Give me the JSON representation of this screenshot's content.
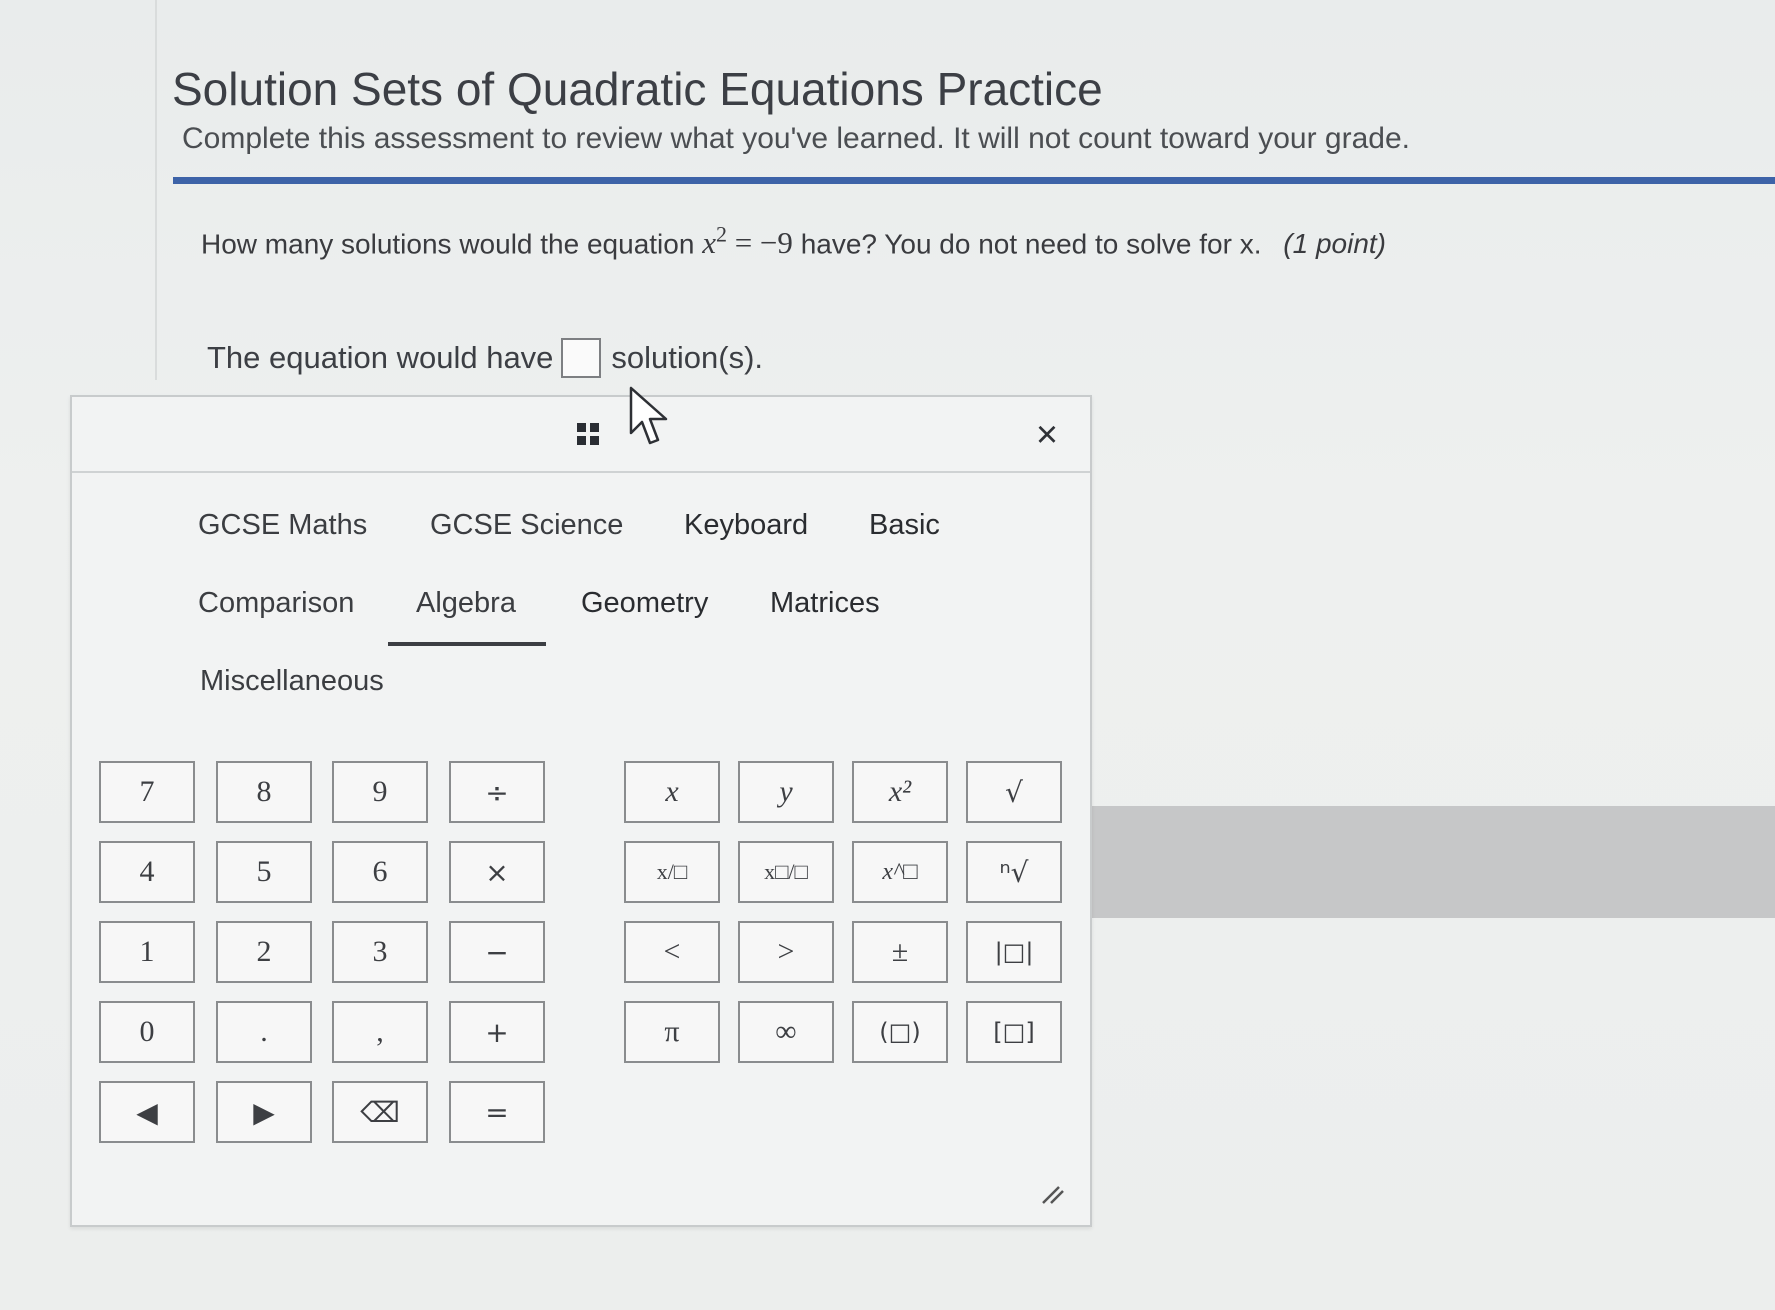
{
  "page": {
    "title": "Solution Sets of Quadratic Equations Practice",
    "subtitle": "Complete this assessment to review what you've learned. It will not count toward your grade.",
    "accent_color": "#3d63a8"
  },
  "question": {
    "prefix": "How many solutions would the equation",
    "equation_var": "x",
    "equation_exp": "2",
    "equation_rest": " = −9",
    "suffix": " have? You do not need to solve for x.",
    "points": "(1 point)"
  },
  "answer": {
    "before": "The equation would have",
    "value": "",
    "after": "solution(s)."
  },
  "palette": {
    "close_label": "×",
    "tabs_row1": [
      "GCSE Maths",
      "GCSE Science",
      "Keyboard",
      "Basic"
    ],
    "tabs_row2": [
      "Comparison",
      "Algebra",
      "Geometry",
      "Matrices"
    ],
    "tabs_row3": [
      "Miscellaneous"
    ],
    "selected_tab": "Algebra",
    "number_keys": [
      [
        "7",
        "8",
        "9",
        "÷"
      ],
      [
        "4",
        "5",
        "6",
        "×"
      ],
      [
        "1",
        "2",
        "3",
        "−"
      ],
      [
        "0",
        ".",
        ",",
        "+"
      ],
      [
        "◀",
        "▶",
        "⌫",
        "="
      ]
    ],
    "algebra_keys": [
      [
        "x",
        "y",
        "x²",
        "√"
      ],
      [
        "x/□",
        "x□/□",
        "x^□",
        "ⁿ√"
      ],
      [
        "<",
        ">",
        "±",
        "|□|"
      ],
      [
        "π",
        "∞",
        "(□)",
        "[□]"
      ]
    ],
    "icons": {
      "drag": "drag-handle-icon",
      "close": "close-icon",
      "resize": "resize-grip-icon",
      "left": "left-arrow-icon",
      "right": "right-arrow-icon",
      "backspace": "backspace-icon"
    }
  }
}
